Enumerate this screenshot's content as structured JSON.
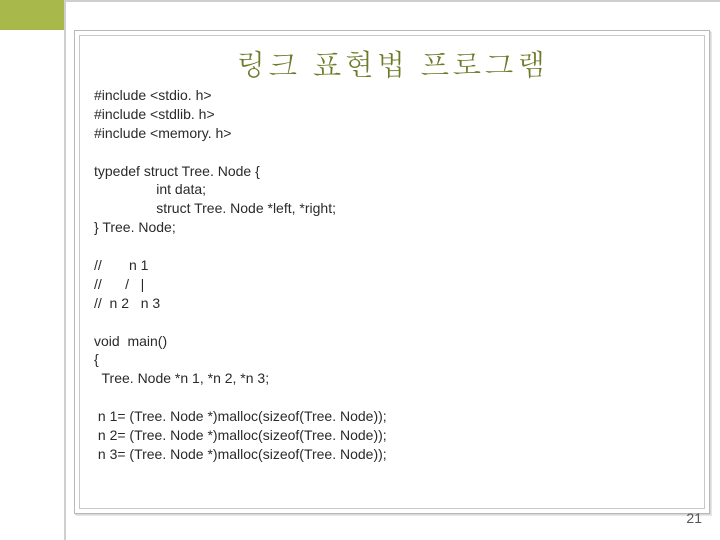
{
  "title": "링크 표현법 프로그램",
  "code_lines": [
    "#include <stdio. h>",
    "#include <stdlib. h>",
    "#include <memory. h>",
    "",
    "typedef struct Tree. Node {",
    "                int data;",
    "                struct Tree. Node *left, *right;",
    "} Tree. Node;",
    "",
    "//       n 1",
    "//      /   |",
    "//  n 2   n 3",
    "",
    "void  main()",
    "{",
    "  Tree. Node *n 1, *n 2, *n 3;",
    "",
    " n 1= (Tree. Node *)malloc(sizeof(Tree. Node));",
    " n 2= (Tree. Node *)malloc(sizeof(Tree. Node));",
    " n 3= (Tree. Node *)malloc(sizeof(Tree. Node));"
  ],
  "page_number": "21"
}
